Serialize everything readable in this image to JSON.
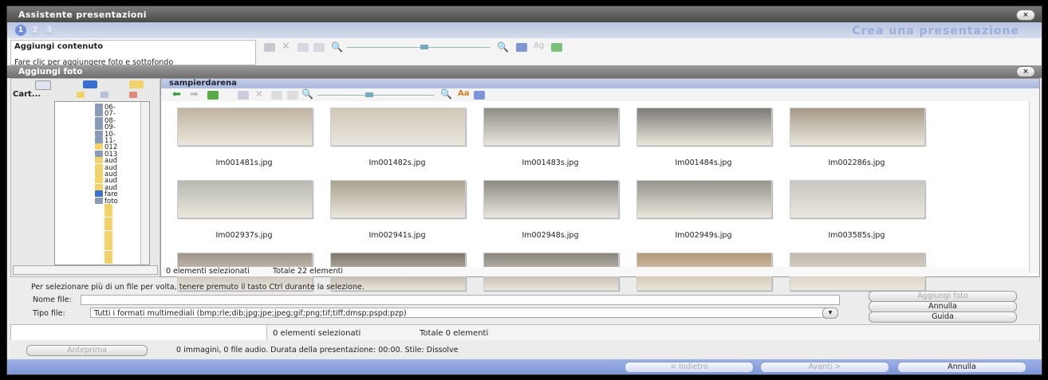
{
  "window": {
    "title": "Assistente presentazioni",
    "close_label": "×"
  },
  "steps": {
    "items": [
      "1",
      "2",
      "3"
    ],
    "heading": "Crea una presentazione"
  },
  "content": {
    "heading": "Aggiungi contenuto",
    "hint": "Fare clic per aggiungere foto e sottofondo"
  },
  "add_photos": {
    "title": "Aggiungi foto",
    "close_label": "×"
  },
  "left_panel": {
    "cart_label": "Cart...",
    "tree_items": [
      {
        "icon": "camera",
        "label": "06-"
      },
      {
        "icon": "camera",
        "label": "07-"
      },
      {
        "icon": "camera",
        "label": "08-"
      },
      {
        "icon": "camera",
        "label": "09-"
      },
      {
        "icon": "camera",
        "label": "10-"
      },
      {
        "icon": "camera",
        "label": "11-"
      },
      {
        "icon": "folder",
        "label": "012"
      },
      {
        "icon": "camera",
        "label": "013"
      },
      {
        "icon": "folder",
        "label": "aud"
      },
      {
        "icon": "folder",
        "label": "aud"
      },
      {
        "icon": "folder",
        "label": "aud"
      },
      {
        "icon": "folder",
        "label": "aud"
      },
      {
        "icon": "folder",
        "label": "aud"
      },
      {
        "icon": "globe",
        "label": "fare"
      },
      {
        "icon": "camera",
        "label": "foto"
      },
      {
        "icon": "folder",
        "label": ""
      },
      {
        "icon": "folder",
        "label": ""
      },
      {
        "icon": "folder",
        "label": ""
      },
      {
        "icon": "folder",
        "label": ""
      },
      {
        "icon": "folder",
        "label": ""
      },
      {
        "icon": "folder",
        "label": ""
      },
      {
        "icon": "folder",
        "label": ""
      },
      {
        "icon": "folder",
        "label": ""
      },
      {
        "icon": "folder",
        "label": ""
      }
    ]
  },
  "browser": {
    "folder": "sampierdarena",
    "files": [
      {
        "name": "Im001481s.jpg",
        "tone": "#bfb3a0"
      },
      {
        "name": "Im001482s.jpg",
        "tone": "#cfc7b8"
      },
      {
        "name": "Im001483s.jpg",
        "tone": "#8f8c86"
      },
      {
        "name": "Im001484s.jpg",
        "tone": "#7d7b77"
      },
      {
        "name": "Im002286s.jpg",
        "tone": "#a59a88"
      },
      {
        "name": "Im002937s.jpg",
        "tone": "#b8b8b2"
      },
      {
        "name": "Im002941s.jpg",
        "tone": "#a9a28f"
      },
      {
        "name": "Im002948s.jpg",
        "tone": "#8d8a84"
      },
      {
        "name": "Im002949s.jpg",
        "tone": "#96938c"
      },
      {
        "name": "Im003585s.jpg",
        "tone": "#c9c7c0"
      },
      {
        "name": "",
        "tone": "#9e9588"
      },
      {
        "name": "",
        "tone": "#7f776b"
      },
      {
        "name": "",
        "tone": "#8b867d"
      },
      {
        "name": "",
        "tone": "#b39a78"
      },
      {
        "name": "",
        "tone": "#c2baad"
      }
    ],
    "selected_count": "0 elementi selezionati",
    "total_count": "Totale 22 elementi"
  },
  "form": {
    "hint": "Per selezionare più di un file per volta, tenere premuto il tasto Ctrl durante la selezione.",
    "filename_label": "Nome file:",
    "filename_value": "",
    "filetype_label": "Tipo file:",
    "filetype_value": "Tutti i formati multimediali (bmp;rle;dib;jpg;jpe;jpeg;gif;png;tif;tiff;dmsp;pspd;pzp)",
    "add_button": "Aggiungi foto",
    "cancel_button": "Annulla",
    "help_button": "Guida"
  },
  "status": {
    "selected": "0 elementi selezionati",
    "total": "Totale 0 elementi"
  },
  "summary": {
    "preview_button": "Anteprima",
    "text": "0 immagini,  0 file audio. Durata della presentazione: 00:00. Stile: Dissolve"
  },
  "nav": {
    "back": "< Indietro",
    "next": "Avanti >",
    "cancel": "Annulla"
  },
  "colors": {
    "accent": "#7e96d6",
    "title_bar": "#4a4a4a",
    "step_active": "#6f8fd8"
  }
}
